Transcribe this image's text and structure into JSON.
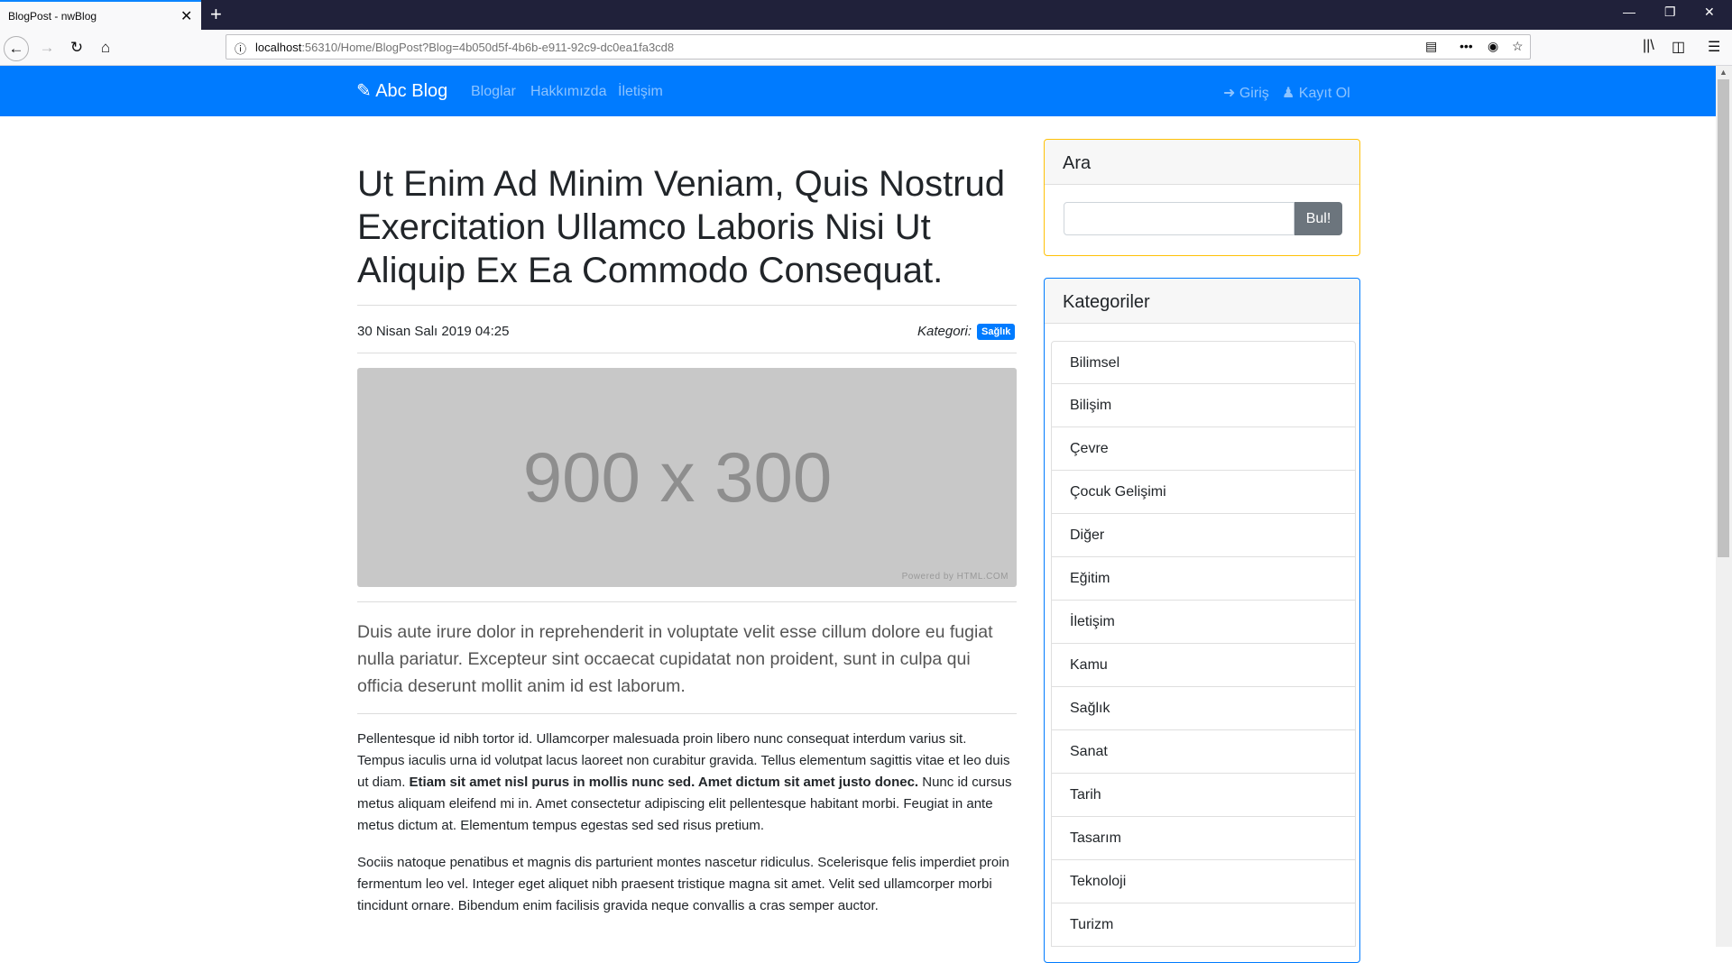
{
  "browser": {
    "tab_title": "BlogPost - nwBlog",
    "url_host": "localhost",
    "url_rest": ":56310/Home/BlogPost?Blog=4b050d5f-4b6b-e911-92c9-dc0ea1fa3cd8"
  },
  "site": {
    "brand": "Abc Blog",
    "nav": [
      "Bloglar",
      "Hakkımızda",
      "İletişim"
    ],
    "login": "Giriş",
    "register": "Kayıt Ol"
  },
  "post": {
    "title": "Ut Enim Ad Minim Veniam, Quis Nostrud Exercitation Ullamco Laboris Nisi Ut Aliquip Ex Ea Commodo Consequat.",
    "date": "30 Nisan Salı 2019 04:25",
    "category_label": "Kategori:",
    "category": "Sağlık",
    "image_text": "900 x 300",
    "image_credit": "Powered by HTML.COM",
    "lead": "Duis aute irure dolor in reprehenderit in voluptate velit esse cillum dolore eu fugiat nulla pariatur. Excepteur sint occaecat cupidatat non proident, sunt in culpa qui officia deserunt mollit anim id est laborum.",
    "p1_a": "Pellentesque id nibh tortor id. Ullamcorper malesuada proin libero nunc consequat interdum varius sit. Tempus iaculis urna id volutpat lacus laoreet non curabitur gravida. Tellus elementum sagittis vitae et leo duis ut diam. ",
    "p1_bold": "Etiam sit amet nisl purus in mollis nunc sed. Amet dictum sit amet justo donec.",
    "p1_b": " Nunc id cursus metus aliquam eleifend mi in. Amet consectetur adipiscing elit pellentesque habitant morbi. Feugiat in ante metus dictum at. Elementum tempus egestas sed sed risus pretium.",
    "p2": "Sociis natoque penatibus et magnis dis parturient montes nascetur ridiculus. Scelerisque felis imperdiet proin fermentum leo vel. Integer eget aliquet nibh praesent tristique magna sit amet. Velit sed ullamcorper morbi tincidunt ornare. Bibendum enim facilisis gravida neque convallis a cras semper auctor."
  },
  "sidebar": {
    "search_title": "Ara",
    "search_button": "Bul!",
    "categories_title": "Kategoriler",
    "categories": [
      "Bilimsel",
      "Bilişim",
      "Çevre",
      "Çocuk Gelişimi",
      "Diğer",
      "Eğitim",
      "İletişim",
      "Kamu",
      "Sağlık",
      "Sanat",
      "Tarih",
      "Tasarım",
      "Teknoloji",
      "Turizm"
    ]
  },
  "colors": {
    "primary": "#007bff",
    "search_border": "#ffc107",
    "categories_border": "#007bff",
    "button": "#6c757d"
  }
}
